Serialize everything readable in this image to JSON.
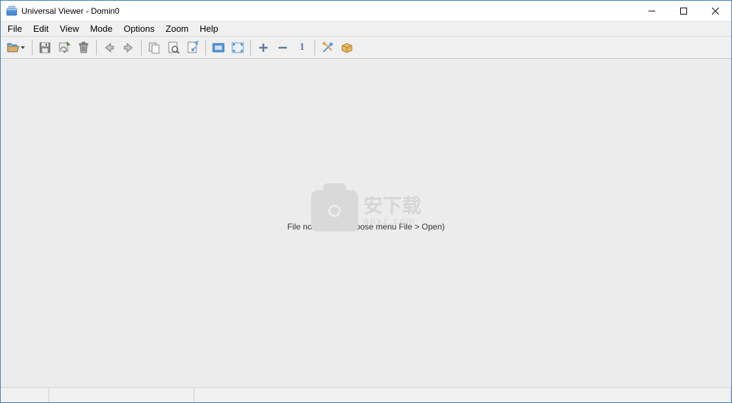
{
  "window": {
    "title": "Universal Viewer - Domin0"
  },
  "menu": {
    "items": [
      "File",
      "Edit",
      "View",
      "Mode",
      "Options",
      "Zoom",
      "Help"
    ]
  },
  "toolbar": {
    "open_label": "Open",
    "save_label": "Save",
    "reload_label": "Reload",
    "delete_label": "Delete",
    "prev_label": "Previous",
    "next_label": "Next",
    "copy_label": "Copy",
    "preview_label": "Preview",
    "fit_label": "Fit Page",
    "fit_width_label": "Fit Width",
    "fullscreen_label": "Fullscreen",
    "zoom_in_label": "Zoom In",
    "zoom_out_label": "Zoom Out",
    "actual_label": "Actual Size (1:1)",
    "actual_digit": "1",
    "options_label": "Options",
    "plugins_label": "Plugins"
  },
  "content": {
    "empty_message": "File not loaded (choose menu File > Open)",
    "watermark_main": "安下载",
    "watermark_sub": "anxz.com"
  },
  "statusbar": {}
}
